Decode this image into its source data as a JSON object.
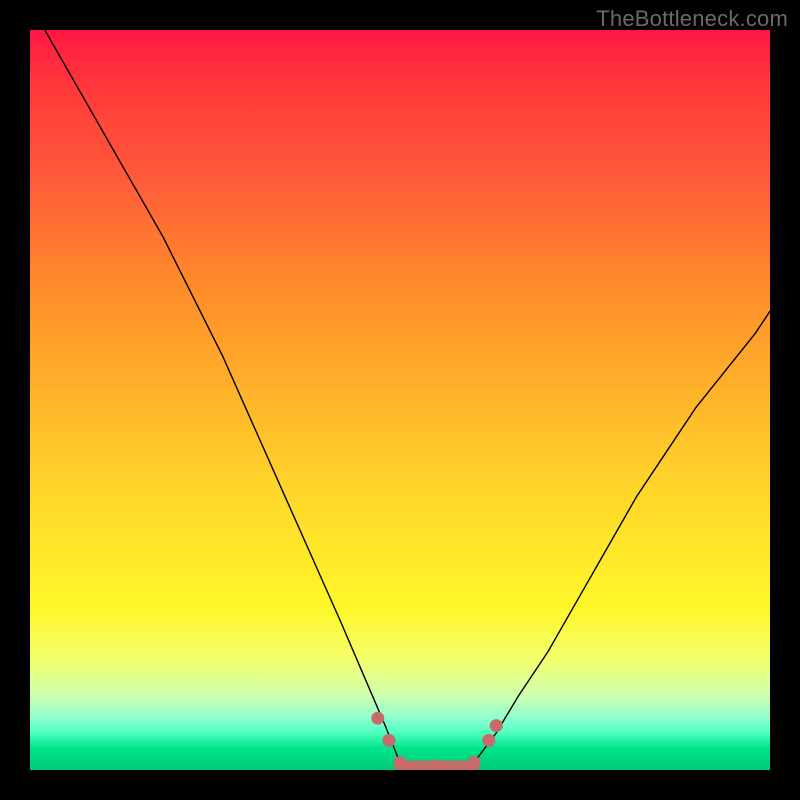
{
  "watermark": "TheBottleneck.com",
  "colors": {
    "frame": "#000000",
    "curve": "#000000",
    "marker": "#c96a6a",
    "gradient_top": "#ff1744",
    "gradient_mid": "#ffeb3b",
    "gradient_bottom": "#00c97a"
  },
  "chart_data": {
    "type": "line",
    "title": "",
    "xlabel": "",
    "ylabel": "",
    "xlim": [
      0,
      100
    ],
    "ylim": [
      0,
      100
    ],
    "grid": false,
    "legend": false,
    "series": [
      {
        "name": "left-branch",
        "x": [
          2,
          6,
          10,
          14,
          18,
          22,
          26,
          30,
          34,
          38,
          42,
          45,
          48,
          50
        ],
        "y": [
          100,
          93,
          86,
          79,
          72,
          64,
          56,
          47,
          38,
          29,
          20,
          13,
          6,
          1
        ]
      },
      {
        "name": "right-branch",
        "x": [
          60,
          63,
          66,
          70,
          74,
          78,
          82,
          86,
          90,
          94,
          98,
          100
        ],
        "y": [
          1,
          5,
          10,
          16,
          23,
          30,
          37,
          43,
          49,
          54,
          59,
          62
        ]
      }
    ],
    "valley_floor": {
      "x_start": 50,
      "x_end": 60,
      "y": 0.5
    },
    "marker_points": [
      {
        "x": 47,
        "y": 7
      },
      {
        "x": 48.5,
        "y": 4
      },
      {
        "x": 50,
        "y": 1
      },
      {
        "x": 55,
        "y": 0.5
      },
      {
        "x": 60,
        "y": 1
      },
      {
        "x": 62,
        "y": 4
      },
      {
        "x": 63,
        "y": 6
      }
    ]
  }
}
